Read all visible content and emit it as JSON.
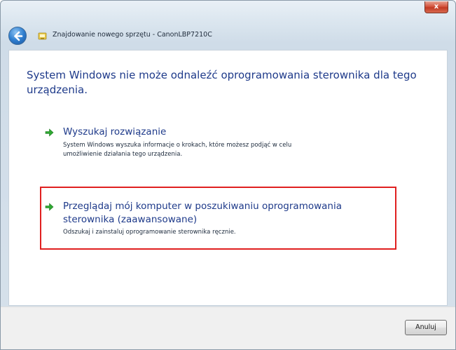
{
  "window": {
    "title": "Znajdowanie nowego sprzętu - CanonLBP7210C",
    "close_label": "x"
  },
  "content": {
    "heading": "System Windows nie może odnaleźć oprogramowania sterownika dla tego urządzenia.",
    "options": [
      {
        "title": "Wyszukaj rozwiązanie",
        "description": "System Windows wyszuka informacje o krokach, które możesz podjąć w celu umożliwienie działania tego urządzenia."
      },
      {
        "title": "Przeglądaj mój komputer w poszukiwaniu oprogramowania sterownika (zaawansowane)",
        "description": "Odszukaj i zainstaluj oprogramowanie sterownika ręcznie."
      }
    ]
  },
  "footer": {
    "cancel_label": "Anuluj"
  },
  "colors": {
    "heading": "#1e3a8a",
    "arrow": "#2fa832",
    "highlight": "#e02020"
  }
}
